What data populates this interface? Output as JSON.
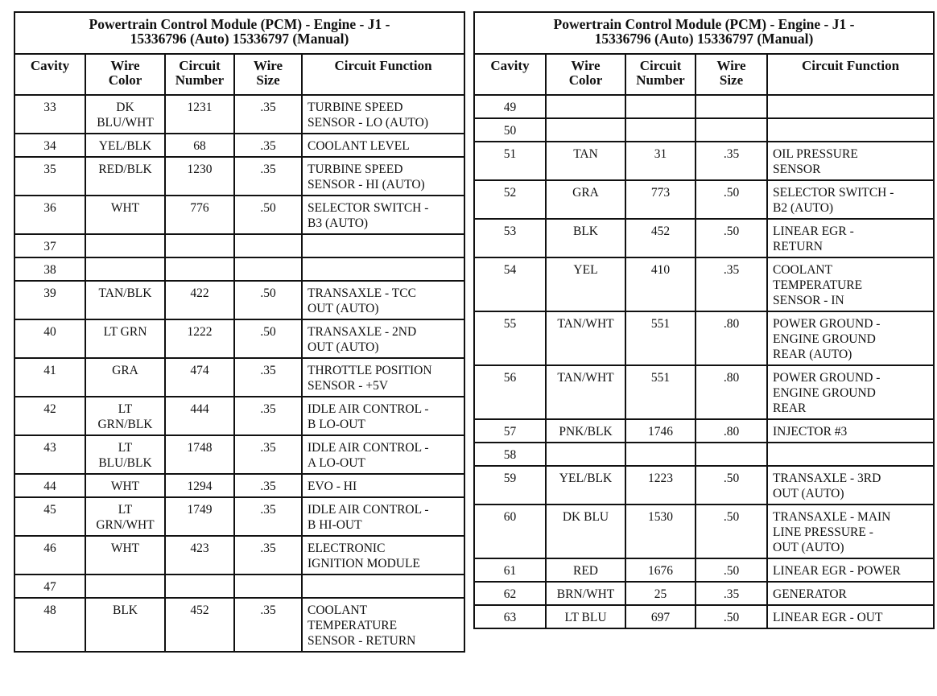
{
  "tables": [
    {
      "title_line1": "Powertrain Control Module (PCM) - Engine - J1 -",
      "title_line2": "15336796 (Auto) 15336797 (Manual)",
      "columns": [
        "Cavity",
        "Wire\nColor",
        "Circuit\nNumber",
        "Wire\nSize",
        "Circuit Function"
      ],
      "rows": [
        {
          "cavity": "33",
          "wire_color": "DK\nBLU/WHT",
          "circuit_number": "1231",
          "wire_size": ".35",
          "function": "TURBINE SPEED\nSENSOR - LO (AUTO)"
        },
        {
          "cavity": "34",
          "wire_color": "YEL/BLK",
          "circuit_number": "68",
          "wire_size": ".35",
          "function": "COOLANT LEVEL"
        },
        {
          "cavity": "35",
          "wire_color": "RED/BLK",
          "circuit_number": "1230",
          "wire_size": ".35",
          "function": "TURBINE SPEED\nSENSOR - HI (AUTO)"
        },
        {
          "cavity": "36",
          "wire_color": "WHT",
          "circuit_number": "776",
          "wire_size": ".50",
          "function": "SELECTOR SWITCH -\nB3 (AUTO)"
        },
        {
          "cavity": "37",
          "wire_color": "",
          "circuit_number": "",
          "wire_size": "",
          "function": ""
        },
        {
          "cavity": "38",
          "wire_color": "",
          "circuit_number": "",
          "wire_size": "",
          "function": ""
        },
        {
          "cavity": "39",
          "wire_color": "TAN/BLK",
          "circuit_number": "422",
          "wire_size": ".50",
          "function": "TRANSAXLE - TCC\nOUT (AUTO)"
        },
        {
          "cavity": "40",
          "wire_color": "LT GRN",
          "circuit_number": "1222",
          "wire_size": ".50",
          "function": "TRANSAXLE - 2ND\nOUT (AUTO)"
        },
        {
          "cavity": "41",
          "wire_color": "GRA",
          "circuit_number": "474",
          "wire_size": ".35",
          "function": "THROTTLE POSITION\nSENSOR - +5V"
        },
        {
          "cavity": "42",
          "wire_color": "LT\nGRN/BLK",
          "circuit_number": "444",
          "wire_size": ".35",
          "function": "IDLE AIR CONTROL -\nB LO-OUT"
        },
        {
          "cavity": "43",
          "wire_color": "LT\nBLU/BLK",
          "circuit_number": "1748",
          "wire_size": ".35",
          "function": "IDLE AIR CONTROL -\nA LO-OUT"
        },
        {
          "cavity": "44",
          "wire_color": "WHT",
          "circuit_number": "1294",
          "wire_size": ".35",
          "function": "EVO - HI"
        },
        {
          "cavity": "45",
          "wire_color": "LT\nGRN/WHT",
          "circuit_number": "1749",
          "wire_size": ".35",
          "function": "IDLE AIR CONTROL -\nB HI-OUT"
        },
        {
          "cavity": "46",
          "wire_color": "WHT",
          "circuit_number": "423",
          "wire_size": ".35",
          "function": "ELECTRONIC\nIGNITION MODULE"
        },
        {
          "cavity": "47",
          "wire_color": "",
          "circuit_number": "",
          "wire_size": "",
          "function": ""
        },
        {
          "cavity": "48",
          "wire_color": "BLK",
          "circuit_number": "452",
          "wire_size": ".35",
          "function": "COOLANT\nTEMPERATURE\nSENSOR - RETURN"
        }
      ]
    },
    {
      "title_line1": "Powertrain Control Module (PCM) - Engine - J1 -",
      "title_line2": "15336796 (Auto) 15336797 (Manual)",
      "columns": [
        "Cavity",
        "Wire\nColor",
        "Circuit\nNumber",
        "Wire\nSize",
        "Circuit Function"
      ],
      "rows": [
        {
          "cavity": "49",
          "wire_color": "",
          "circuit_number": "",
          "wire_size": "",
          "function": ""
        },
        {
          "cavity": "50",
          "wire_color": "",
          "circuit_number": "",
          "wire_size": "",
          "function": ""
        },
        {
          "cavity": "51",
          "wire_color": "TAN",
          "circuit_number": "31",
          "wire_size": ".35",
          "function": "OIL PRESSURE\nSENSOR"
        },
        {
          "cavity": "52",
          "wire_color": "GRA",
          "circuit_number": "773",
          "wire_size": ".50",
          "function": "SELECTOR SWITCH -\nB2 (AUTO)"
        },
        {
          "cavity": "53",
          "wire_color": "BLK",
          "circuit_number": "452",
          "wire_size": ".50",
          "function": "LINEAR EGR -\nRETURN"
        },
        {
          "cavity": "54",
          "wire_color": "YEL",
          "circuit_number": "410",
          "wire_size": ".35",
          "function": "COOLANT\nTEMPERATURE\nSENSOR - IN"
        },
        {
          "cavity": "55",
          "wire_color": "TAN/WHT",
          "circuit_number": "551",
          "wire_size": ".80",
          "function": "POWER GROUND -\nENGINE GROUND\nREAR (AUTO)"
        },
        {
          "cavity": "56",
          "wire_color": "TAN/WHT",
          "circuit_number": "551",
          "wire_size": ".80",
          "function": "POWER GROUND -\nENGINE GROUND\nREAR"
        },
        {
          "cavity": "57",
          "wire_color": "PNK/BLK",
          "circuit_number": "1746",
          "wire_size": ".80",
          "function": "INJECTOR #3"
        },
        {
          "cavity": "58",
          "wire_color": "",
          "circuit_number": "",
          "wire_size": "",
          "function": ""
        },
        {
          "cavity": "59",
          "wire_color": "YEL/BLK",
          "circuit_number": "1223",
          "wire_size": ".50",
          "function": "TRANSAXLE - 3RD\nOUT (AUTO)"
        },
        {
          "cavity": "60",
          "wire_color": "DK BLU",
          "circuit_number": "1530",
          "wire_size": ".50",
          "function": "TRANSAXLE - MAIN\nLINE PRESSURE -\nOUT (AUTO)"
        },
        {
          "cavity": "61",
          "wire_color": "RED",
          "circuit_number": "1676",
          "wire_size": ".50",
          "function": "LINEAR EGR - POWER"
        },
        {
          "cavity": "62",
          "wire_color": "BRN/WHT",
          "circuit_number": "25",
          "wire_size": ".35",
          "function": "GENERATOR"
        },
        {
          "cavity": "63",
          "wire_color": "LT BLU",
          "circuit_number": "697",
          "wire_size": ".50",
          "function": "LINEAR EGR - OUT"
        }
      ]
    }
  ]
}
